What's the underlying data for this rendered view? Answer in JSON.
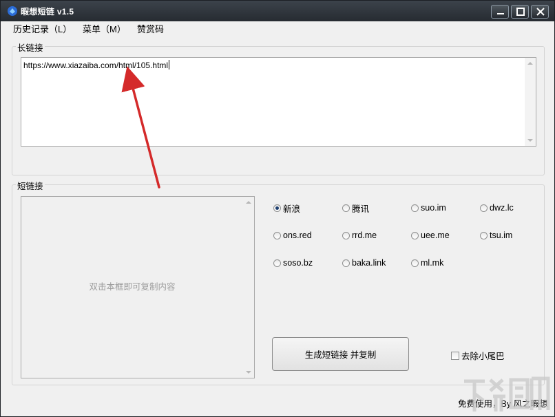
{
  "window": {
    "title": "暇想短链 v1.5",
    "accent_color": "#2b6cd8"
  },
  "titlebar_buttons": [
    "minimize-icon",
    "maximize-icon",
    "close-icon"
  ],
  "menu": {
    "history": "历史记录（L）",
    "menu": "菜单（M）",
    "donate": "赞赏码"
  },
  "long_link": {
    "label": "长链接",
    "value": "https://www.xiazaiba.com/html/105.html"
  },
  "short_link": {
    "label": "短链接",
    "placeholder": "双击本框即可复制内容"
  },
  "providers": [
    {
      "label": "新浪",
      "checked": true
    },
    {
      "label": "腾讯",
      "checked": false
    },
    {
      "label": "suo.im",
      "checked": false
    },
    {
      "label": "dwz.lc",
      "checked": false
    },
    {
      "label": "ons.red",
      "checked": false
    },
    {
      "label": "rrd.me",
      "checked": false
    },
    {
      "label": "uee.me",
      "checked": false
    },
    {
      "label": "tsu.im",
      "checked": false
    },
    {
      "label": "soso.bz",
      "checked": false
    },
    {
      "label": "baka.link",
      "checked": false
    },
    {
      "label": "ml.mk",
      "checked": false
    }
  ],
  "actions": {
    "generate_button": "生成短链接 并复制",
    "remove_tail_label": "去除小尾巴",
    "remove_tail_checked": false
  },
  "footer": {
    "text": "免费使用，By 风之暇想"
  },
  "annotation": {
    "arrow_color": "#d42a2a"
  }
}
